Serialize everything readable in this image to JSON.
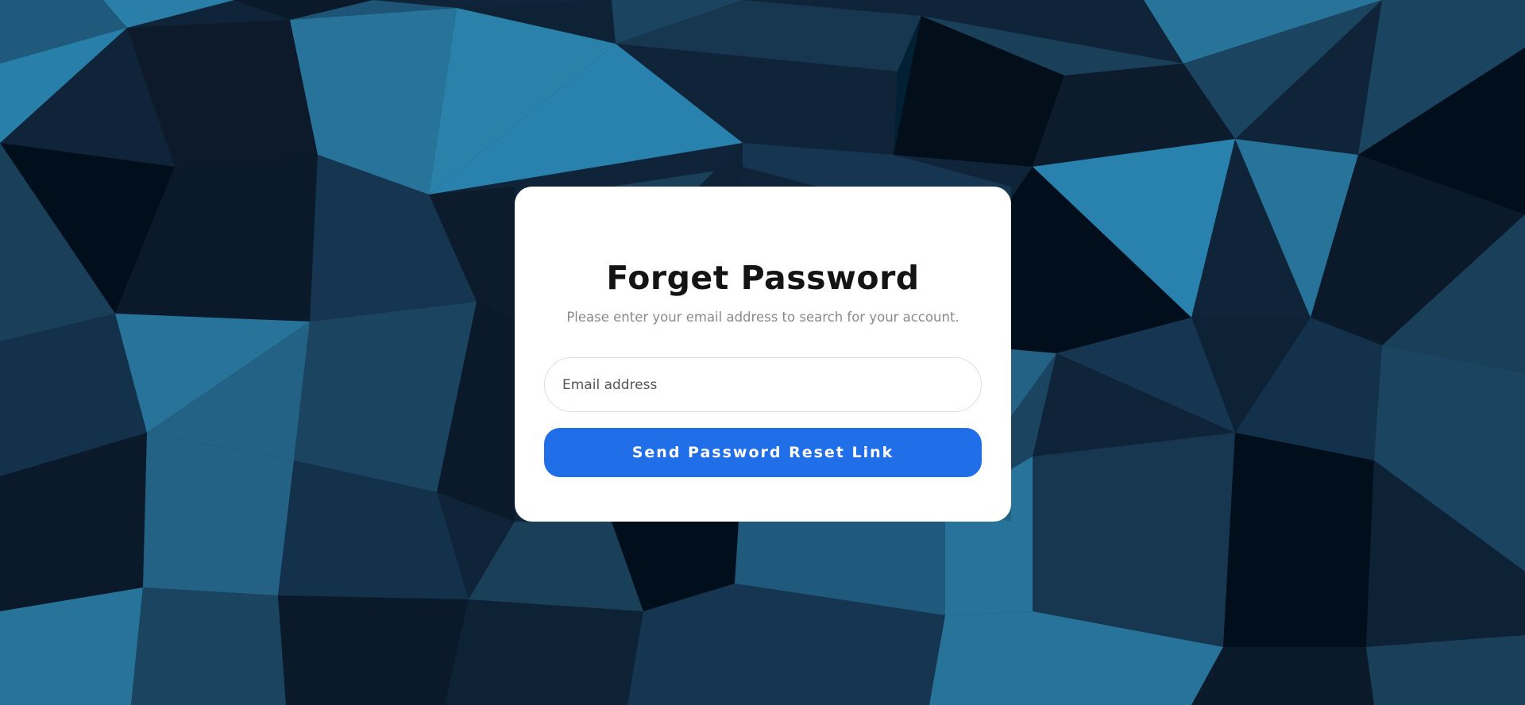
{
  "form": {
    "title": "Forget Password",
    "subtitle": "Please enter your email address to search for your account.",
    "email_placeholder": "Email address",
    "email_value": "",
    "submit_label": "Send Password Reset Link"
  },
  "colors": {
    "button_background": "#206ee8",
    "button_text": "#ffffff",
    "card_background": "#ffffff",
    "title_text": "#141414",
    "subtitle_text": "#8a8a8a",
    "background_palette": [
      "#010f1c",
      "#0b1a2a",
      "#122a40",
      "#1a3f59",
      "#235e80",
      "#27739a",
      "#2a82aa"
    ]
  }
}
